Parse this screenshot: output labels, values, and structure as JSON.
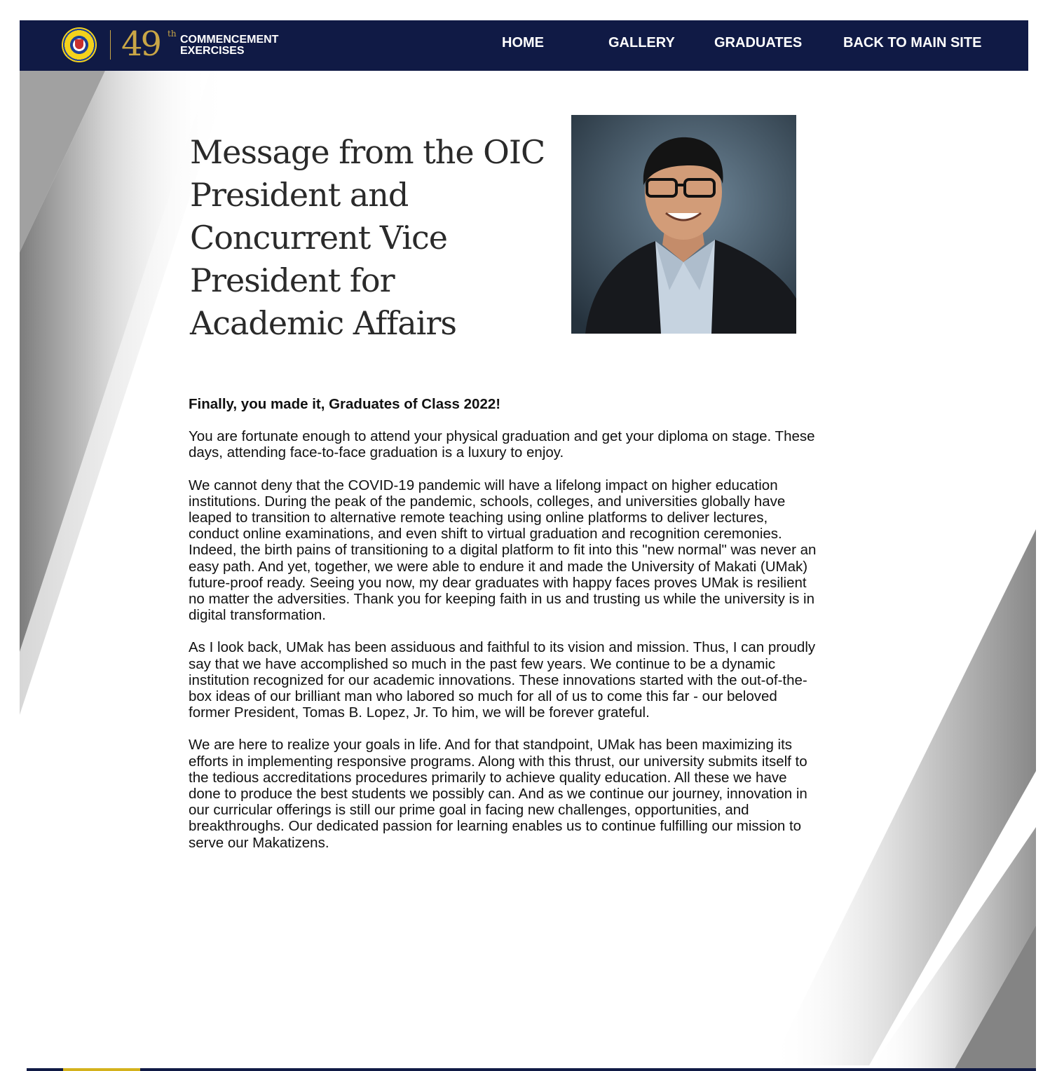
{
  "header": {
    "seal_label": "UNIVERSITY OF MAKATI",
    "anniversary_number": "49",
    "anniversary_suffix": "th",
    "event_line1": "COMMENCEMENT",
    "event_line2": "EXERCISES",
    "nav": [
      {
        "label": "HOME"
      },
      {
        "label": "GALLERY"
      },
      {
        "label": "GRADUATES"
      },
      {
        "label": "BACK TO MAIN SITE"
      }
    ]
  },
  "page": {
    "title": "Message from the OIC President and Concurrent Vice President for Academic Affairs",
    "photo_alt": "OIC President portrait"
  },
  "message": {
    "lead": "Finally, you made it, Graduates of Class 2022!",
    "paragraphs": [
      "You are fortunate enough to attend your physical graduation and get your diploma on stage. These days, attending face-to-face graduation is a luxury to enjoy.",
      "We cannot deny that the COVID-19 pandemic will have a lifelong impact on higher education institutions. During the peak of the pandemic, schools, colleges, and universities globally have leaped to transition to alternative remote teaching using online platforms to deliver lectures, conduct online examinations, and even shift to virtual graduation and recognition ceremonies. Indeed, the birth pains of transitioning to a digital platform to fit into this \"new normal\" was never an easy path. And yet, together, we were able to endure it and made the University of Makati (UMak) future-proof ready. Seeing you now, my dear graduates with happy faces proves UMak is resilient no matter the adversities. Thank you for keeping faith in us and trusting us while the university is in digital transformation.",
      "As I look back, UMak has been assiduous and faithful to its vision and mission. Thus, I can proudly say that we have accomplished so much in the past few years. We continue to be a dynamic institution recognized for our academic innovations. These innovations started with the out-of-the-box ideas of our brilliant man who labored so much for all of us to come this far - our beloved former President, Tomas B. Lopez, Jr. To him, we will be forever grateful.",
      "We are here to realize your goals in life. And for that standpoint, UMak has been maximizing its efforts in implementing responsive programs. Along with this thrust, our university submits itself to the tedious accreditations procedures primarily to achieve quality education. All these we have done to produce the best students we possibly can. And as we continue our journey, innovation in our curricular offerings is still our prime goal in facing new challenges, opportunities, and breakthroughs. Our dedicated passion for learning enables us to continue fulfilling our mission to serve our Makatizens."
    ]
  },
  "colors": {
    "header_bg": "#101a45",
    "gold": "#c9a646",
    "seal_yellow": "#f4d21c"
  }
}
